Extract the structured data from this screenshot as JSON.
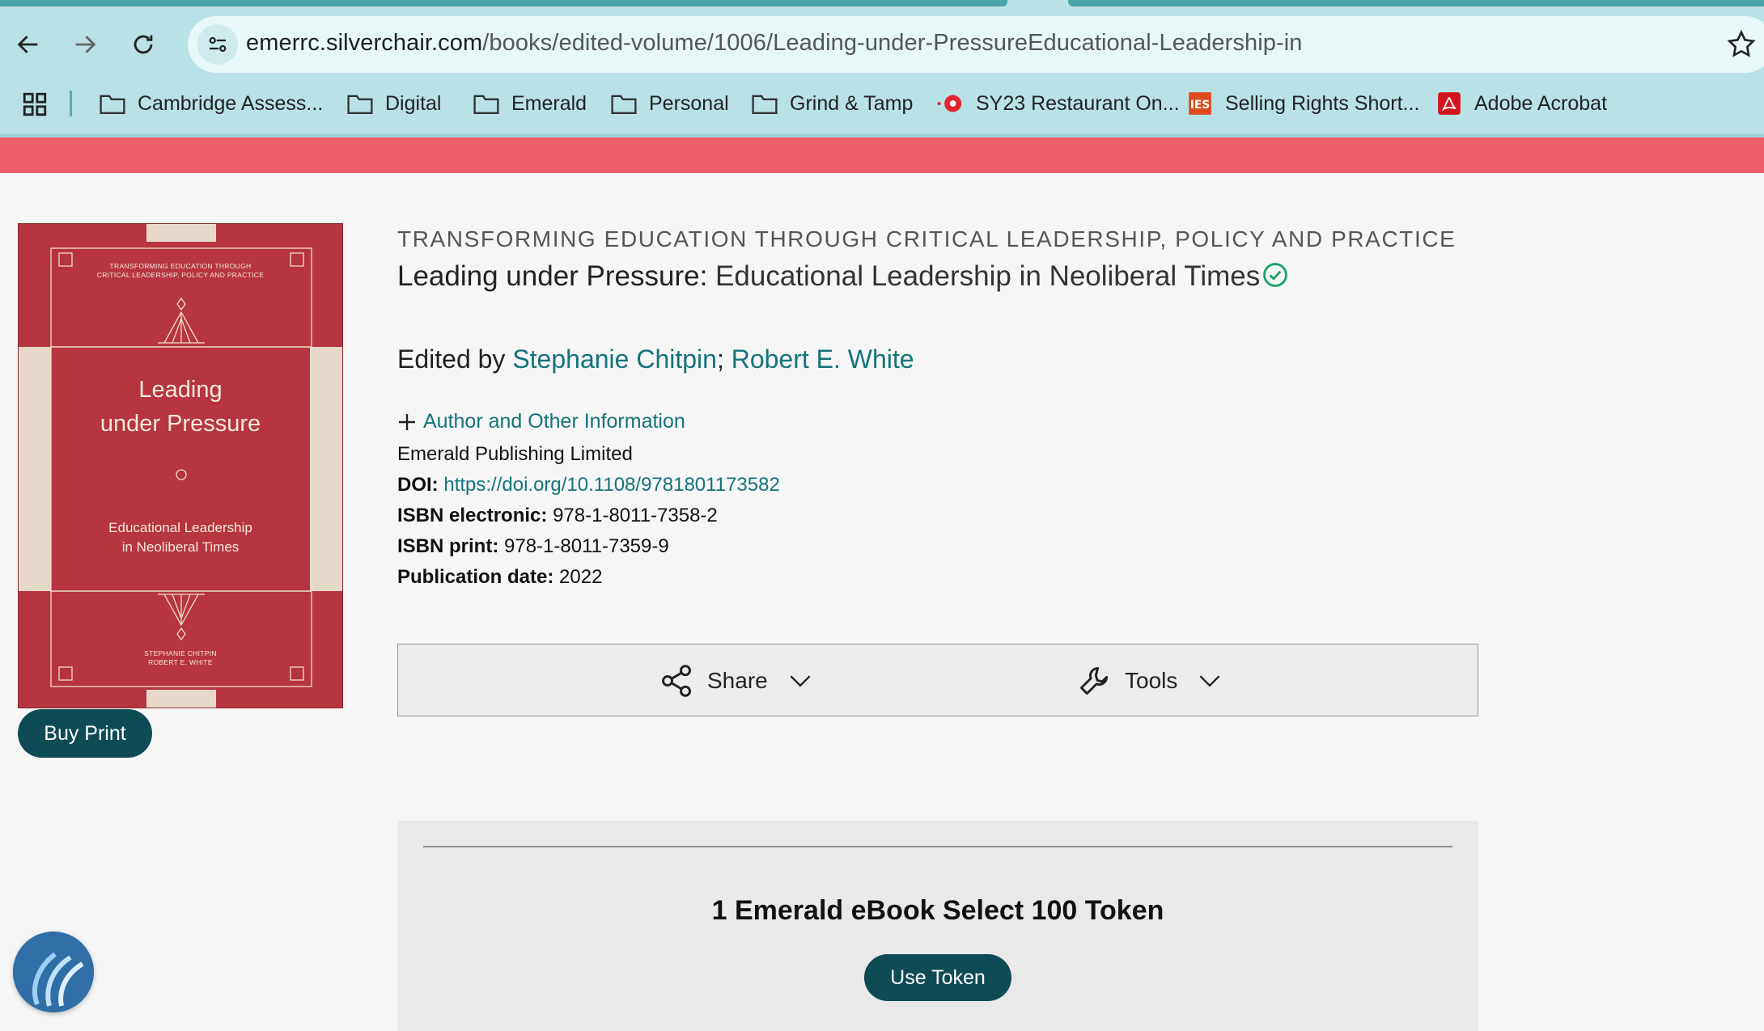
{
  "browser": {
    "url_host": "emerrc.silverchair.com",
    "url_path": "/books/edited-volume/1006/Leading-under-PressureEducational-Leadership-in",
    "bookmarks": [
      {
        "label": "Cambridge Assess...",
        "icon": "folder-icon"
      },
      {
        "label": "Digital",
        "icon": "folder-icon"
      },
      {
        "label": "Emerald",
        "icon": "folder-icon"
      },
      {
        "label": "Personal",
        "icon": "folder-icon"
      },
      {
        "label": "Grind & Tamp",
        "icon": "folder-icon"
      },
      {
        "label": "SY23 Restaurant On...",
        "icon": "record-icon"
      },
      {
        "label": "Selling Rights Short...",
        "icon": "ies-icon"
      },
      {
        "label": "Adobe Acrobat",
        "icon": "acrobat-icon"
      }
    ]
  },
  "cover": {
    "series_line1": "TRANSFORMING EDUCATION THROUGH",
    "series_line2": "CRITICAL LEADERSHIP, POLICY AND PRACTICE",
    "title_line1": "Leading",
    "title_line2": "under Pressure",
    "subtitle_line1": "Educational Leadership",
    "subtitle_line2": "in Neoliberal Times",
    "editor_line1": "STEPHANIE CHITPIN",
    "editor_line2": "ROBERT E. WHITE"
  },
  "buy_print_label": "Buy Print",
  "book": {
    "series": "TRANSFORMING EDUCATION THROUGH CRITICAL LEADERSHIP, POLICY AND PRACTICE",
    "title": "Leading under Pressure",
    "title_sep": ":",
    "subtitle": " Educational Leadership in Neoliberal Times",
    "edited_by": "Edited by",
    "editor1": "Stephanie Chitpin",
    "editor_sep": ";",
    "editor2": "Robert E. White",
    "author_info_label": "Author and Other Information",
    "publisher": "Emerald Publishing Limited",
    "doi_label": "DOI:",
    "doi_value": "https://doi.org/10.1108/9781801173582",
    "isbn_e_label": "ISBN electronic:",
    "isbn_e_value": "978-1-8011-7358-2",
    "isbn_p_label": "ISBN print:",
    "isbn_p_value": "978-1-8011-7359-9",
    "pubdate_label": "Publication date:",
    "pubdate_value": "2022"
  },
  "toolbar": {
    "share_label": "Share",
    "tools_label": "Tools"
  },
  "token_panel": {
    "title": "1 Emerald eBook Select 100 Token",
    "button_label": "Use Token"
  },
  "colors": {
    "brand_teal": "#0f4b56",
    "link": "#14737c",
    "red_band": "#ec5e66",
    "cover_red": "#b6353e"
  }
}
